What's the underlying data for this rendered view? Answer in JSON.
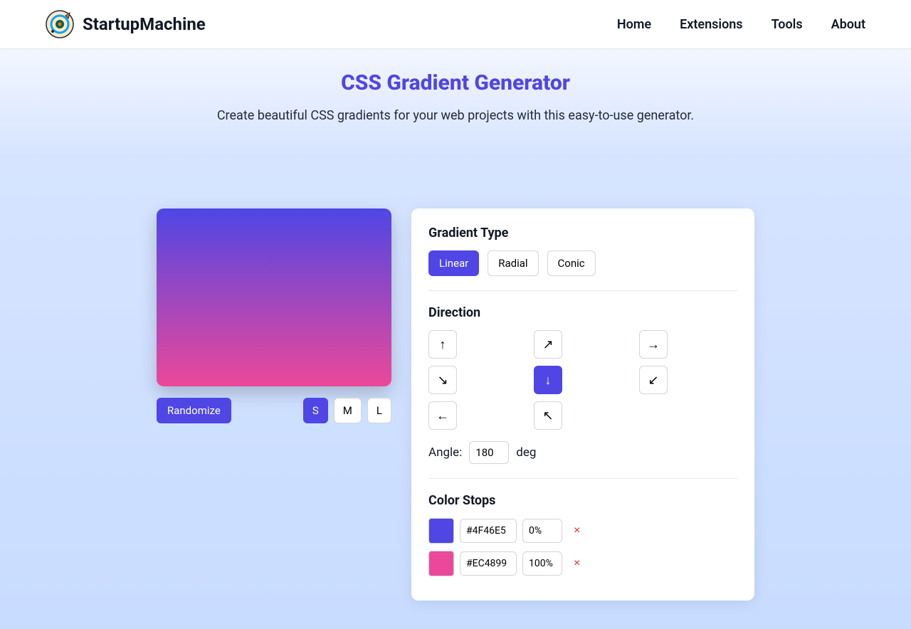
{
  "nav": {
    "brand": "StartupMachine",
    "links": [
      "Home",
      "Extensions",
      "Tools",
      "About"
    ]
  },
  "hero": {
    "title": "CSS Gradient Generator",
    "subtitle": "Create beautiful CSS gradients for your web projects with this easy-to-use generator."
  },
  "preview": {
    "gradient_css": "linear-gradient(180deg, #4F46E5 0%, #EC4899 100%)"
  },
  "controls": {
    "randomize_label": "Randomize",
    "sizes": [
      "S",
      "M",
      "L"
    ],
    "active_size": "S"
  },
  "panel": {
    "gradient_type": {
      "heading": "Gradient Type",
      "options": [
        "Linear",
        "Radial",
        "Conic"
      ],
      "active": "Linear"
    },
    "direction": {
      "heading": "Direction",
      "arrows": [
        "↑",
        "↗",
        "→",
        "↘",
        "↓",
        "↙",
        "←",
        "↖"
      ],
      "active_index": 4,
      "angle_label": "Angle:",
      "angle_value": "180",
      "angle_unit": "deg"
    },
    "color_stops": {
      "heading": "Color Stops",
      "stops": [
        {
          "color": "#4F46E5",
          "hex": "#4F46E5",
          "position": "0%"
        },
        {
          "color": "#EC4899",
          "hex": "#EC4899",
          "position": "100%"
        }
      ]
    }
  }
}
